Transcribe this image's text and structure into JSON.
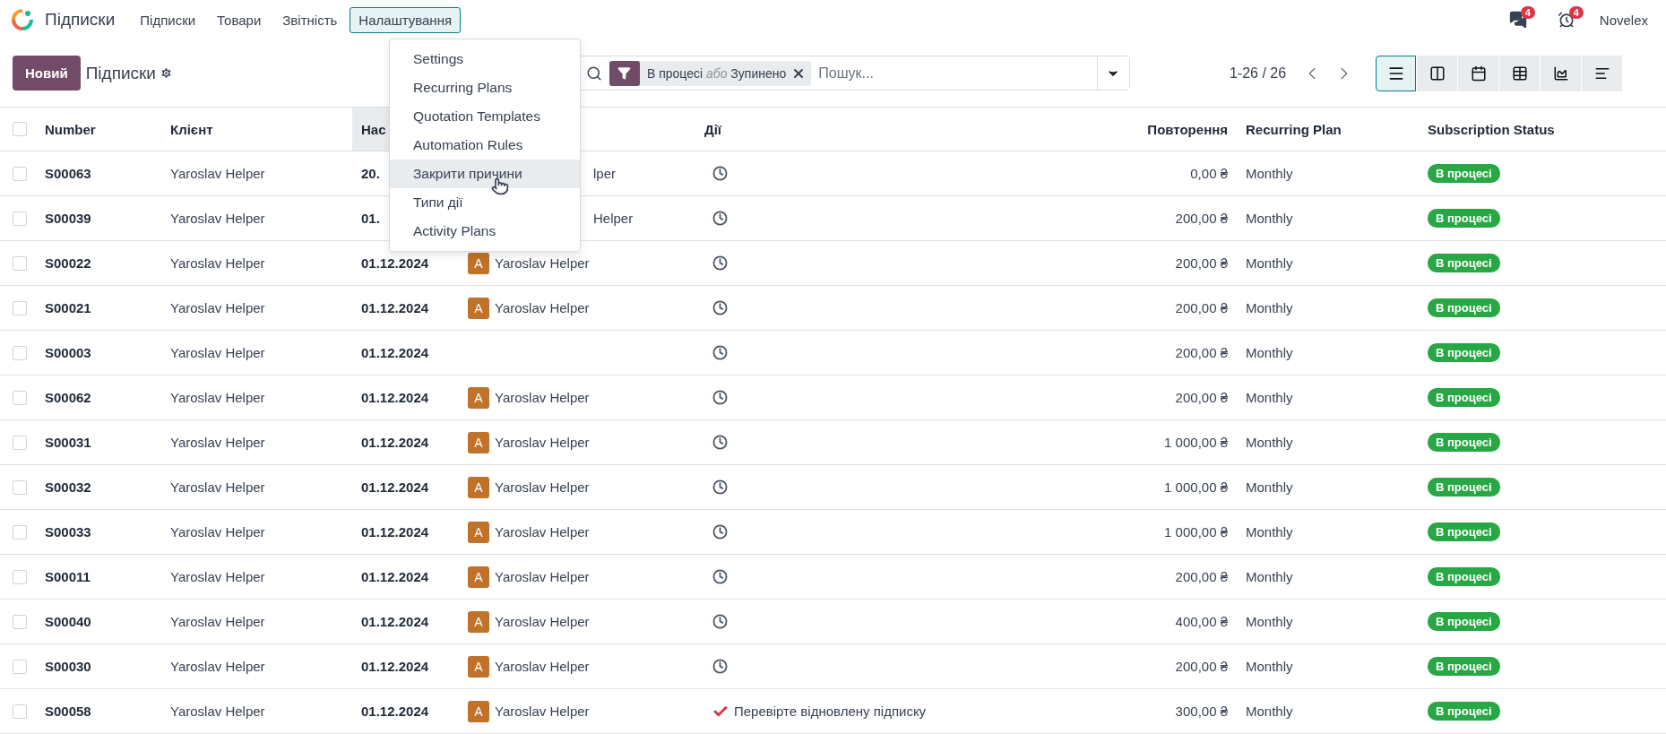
{
  "app": {
    "name": "Підписки"
  },
  "menu": [
    {
      "label": "Підписки",
      "selected": false
    },
    {
      "label": "Товари",
      "selected": false
    },
    {
      "label": "Звітність",
      "selected": false
    },
    {
      "label": "Налаштування",
      "selected": true
    }
  ],
  "settings_menu": {
    "items": [
      {
        "label": "Settings",
        "selected": false
      },
      {
        "label": "Recurring Plans",
        "selected": false
      },
      {
        "label": "Quotation Templates",
        "selected": false
      },
      {
        "label": "Automation Rules",
        "selected": false
      },
      {
        "label": "Закрити причини",
        "selected": true
      },
      {
        "label": "Типи дії",
        "selected": false
      },
      {
        "label": "Activity Plans",
        "selected": false
      }
    ]
  },
  "systray": [
    {
      "kind": "chat",
      "badge": "4"
    },
    {
      "kind": "activity",
      "badge": "4"
    }
  ],
  "user": "Novelex",
  "control_panel": {
    "new_button": "Новий",
    "breadcrumb": "Підписки",
    "search": {
      "facet": {
        "first": "В процесі",
        "separator": "або",
        "second": "Зупинено"
      },
      "placeholder": "Пошук..."
    },
    "pager": "1-26 / 26",
    "views": [
      {
        "kind": "list",
        "selected": true
      },
      {
        "kind": "kanban",
        "selected": false
      },
      {
        "kind": "calendar",
        "selected": false
      },
      {
        "kind": "pivot",
        "selected": false
      },
      {
        "kind": "graph",
        "selected": false
      },
      {
        "kind": "activity",
        "selected": false
      }
    ]
  },
  "table": {
    "select_all_checked": false,
    "columns": [
      {
        "kind": "text",
        "label": "Number"
      },
      {
        "kind": "text",
        "label": "Клієнт"
      },
      {
        "kind": "sorted",
        "label": "Нас"
      },
      {
        "kind": "hidden"
      },
      {
        "kind": "center",
        "label": "Дії"
      },
      {
        "kind": "right",
        "label": "Повторення"
      },
      {
        "kind": "text",
        "label": "Recurring Plan"
      },
      {
        "kind": "text",
        "label": "Subscription Status"
      }
    ],
    "rows": [
      {
        "checked": false,
        "number": "S00063",
        "client": "Yaroslav Helper",
        "date": "20.",
        "salesperson": {
          "name": "lper",
          "cut": true
        },
        "activity": {
          "kind": "clock"
        },
        "recurring": "0,00 ₴",
        "plan": "Monthly",
        "status": "В процесі"
      },
      {
        "checked": false,
        "number": "S00039",
        "client": "Yaroslav Helper",
        "date": "01.",
        "salesperson": {
          "name": "Helper",
          "cut": true
        },
        "activity": {
          "kind": "clock"
        },
        "recurring": "200,00 ₴",
        "plan": "Monthly",
        "status": "В процесі"
      },
      {
        "checked": false,
        "number": "S00022",
        "client": "Yaroslav Helper",
        "date": "01.12.2024",
        "salesperson": {
          "avatar": "A",
          "name": "Yaroslav Helper"
        },
        "activity": {
          "kind": "clock"
        },
        "recurring": "200,00 ₴",
        "plan": "Monthly",
        "status": "В процесі"
      },
      {
        "checked": false,
        "number": "S00021",
        "client": "Yaroslav Helper",
        "date": "01.12.2024",
        "salesperson": {
          "avatar": "A",
          "name": "Yaroslav Helper"
        },
        "activity": {
          "kind": "clock"
        },
        "recurring": "200,00 ₴",
        "plan": "Monthly",
        "status": "В процесі"
      },
      {
        "checked": false,
        "number": "S00003",
        "client": "Yaroslav Helper",
        "date": "01.12.2024",
        "activity": {
          "kind": "clock"
        },
        "recurring": "200,00 ₴",
        "plan": "Monthly",
        "status": "В процесі"
      },
      {
        "checked": false,
        "number": "S00062",
        "client": "Yaroslav Helper",
        "date": "01.12.2024",
        "salesperson": {
          "avatar": "A",
          "name": "Yaroslav Helper"
        },
        "activity": {
          "kind": "clock"
        },
        "recurring": "200,00 ₴",
        "plan": "Monthly",
        "status": "В процесі"
      },
      {
        "checked": false,
        "number": "S00031",
        "client": "Yaroslav Helper",
        "date": "01.12.2024",
        "salesperson": {
          "avatar": "A",
          "name": "Yaroslav Helper"
        },
        "activity": {
          "kind": "clock"
        },
        "recurring": "1 000,00 ₴",
        "plan": "Monthly",
        "status": "В процесі"
      },
      {
        "checked": false,
        "number": "S00032",
        "client": "Yaroslav Helper",
        "date": "01.12.2024",
        "salesperson": {
          "avatar": "A",
          "name": "Yaroslav Helper"
        },
        "activity": {
          "kind": "clock"
        },
        "recurring": "1 000,00 ₴",
        "plan": "Monthly",
        "status": "В процесі"
      },
      {
        "checked": false,
        "number": "S00033",
        "client": "Yaroslav Helper",
        "date": "01.12.2024",
        "salesperson": {
          "avatar": "A",
          "name": "Yaroslav Helper"
        },
        "activity": {
          "kind": "clock"
        },
        "recurring": "1 000,00 ₴",
        "plan": "Monthly",
        "status": "В процесі"
      },
      {
        "checked": false,
        "number": "S00011",
        "client": "Yaroslav Helper",
        "date": "01.12.2024",
        "salesperson": {
          "avatar": "A",
          "name": "Yaroslav Helper"
        },
        "activity": {
          "kind": "clock"
        },
        "recurring": "200,00 ₴",
        "plan": "Monthly",
        "status": "В процесі"
      },
      {
        "checked": false,
        "number": "S00040",
        "client": "Yaroslav Helper",
        "date": "01.12.2024",
        "salesperson": {
          "avatar": "A",
          "name": "Yaroslav Helper"
        },
        "activity": {
          "kind": "clock"
        },
        "recurring": "400,00 ₴",
        "plan": "Monthly",
        "status": "В процесі"
      },
      {
        "checked": false,
        "number": "S00030",
        "client": "Yaroslav Helper",
        "date": "01.12.2024",
        "salesperson": {
          "avatar": "A",
          "name": "Yaroslav Helper"
        },
        "activity": {
          "kind": "clock"
        },
        "recurring": "200,00 ₴",
        "plan": "Monthly",
        "status": "В процесі"
      },
      {
        "checked": false,
        "number": "S00058",
        "client": "Yaroslav Helper",
        "date": "01.12.2024",
        "salesperson": {
          "avatar": "A",
          "name": "Yaroslav Helper"
        },
        "activity": {
          "kind": "check",
          "text": "Перевірте відновлену підписку"
        },
        "recurring": "300,00 ₴",
        "plan": "Monthly",
        "status": "В процесі"
      }
    ]
  }
}
